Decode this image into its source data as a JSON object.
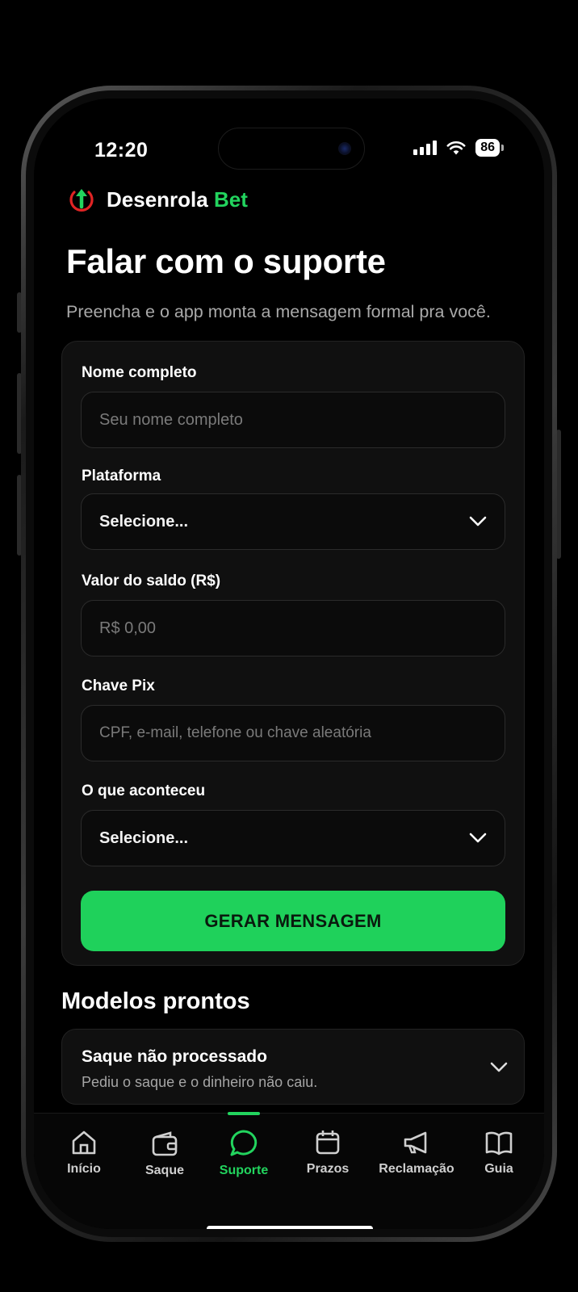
{
  "status": {
    "time": "12:20",
    "battery": "86"
  },
  "brand": {
    "name": "Desenrola",
    "accent": "Bet",
    "accent_color": "#22d45e"
  },
  "page": {
    "title": "Falar com o suporte",
    "subtitle": "Preencha e o app monta a mensagem formal pra você."
  },
  "form": {
    "name_label": "Nome completo",
    "name_placeholder": "Seu nome completo",
    "platform_label": "Plataforma",
    "platform_value": "Selecione...",
    "amount_label": "Valor do saldo (R$)",
    "amount_placeholder": "R$ 0,00",
    "pix_label": "Chave Pix",
    "pix_placeholder": "CPF, e-mail, telefone ou chave aleatória",
    "issue_label": "O que aconteceu",
    "issue_value": "Selecione...",
    "submit_label": "GERAR MENSAGEM",
    "submit_color": "#1fd15b"
  },
  "templates": {
    "title": "Modelos prontos",
    "items": [
      {
        "title": "Saque não processado",
        "description": "Pediu o saque e o dinheiro não caiu."
      }
    ]
  },
  "tabbar": {
    "active": "Suporte",
    "items": [
      {
        "label": "Início",
        "icon": "home-icon"
      },
      {
        "label": "Saque",
        "icon": "wallet-icon"
      },
      {
        "label": "Suporte",
        "icon": "chat-icon"
      },
      {
        "label": "Prazos",
        "icon": "calendar-icon"
      },
      {
        "label": "Reclamação",
        "icon": "megaphone-icon"
      },
      {
        "label": "Guia",
        "icon": "book-icon"
      }
    ]
  }
}
